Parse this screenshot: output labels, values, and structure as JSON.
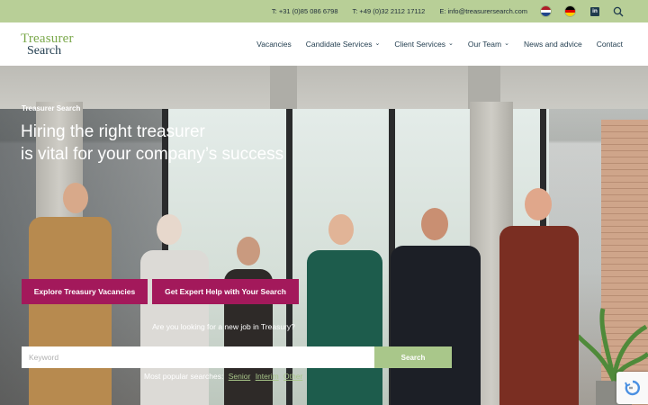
{
  "topbar": {
    "phone_nl": "T: +31 (0)85 086 6798",
    "phone_de": "T: +49 (0)32 2112 17112",
    "email": "E: info@treasurersearch.com",
    "flags": [
      "netherlands-flag-icon",
      "germany-flag-icon"
    ],
    "linkedin": "in"
  },
  "logo": {
    "line1": "Treasurer",
    "line2": "Search"
  },
  "nav": {
    "items": [
      {
        "label": "Vacancies",
        "dropdown": false
      },
      {
        "label": "Candidate Services",
        "dropdown": true
      },
      {
        "label": "Client Services",
        "dropdown": true
      },
      {
        "label": "Our Team",
        "dropdown": true
      },
      {
        "label": "News and advice",
        "dropdown": false
      },
      {
        "label": "Contact",
        "dropdown": false
      }
    ],
    "chevron": "⌄"
  },
  "hero": {
    "eyebrow": "Treasurer Search",
    "title_line1": "Hiring the right treasurer",
    "title_line2": "is vital for your company’s success",
    "btn_vacancies": "Explore Treasury Vacancies",
    "btn_help": "Get Expert Help with Your Search",
    "question": "Are you looking for a new job in Treasury?",
    "search_placeholder": "Keyword",
    "search_button": "Search",
    "popular_label": "Most popular searches:",
    "popular_links": [
      "Senior",
      "Interim",
      "Other"
    ]
  },
  "colors": {
    "topbar_bg": "#b8cf97",
    "brand_green": "#7aa84a",
    "brand_navy": "#1f3b4d",
    "accent_magenta": "#a3195b",
    "search_btn": "#a9c78a"
  }
}
